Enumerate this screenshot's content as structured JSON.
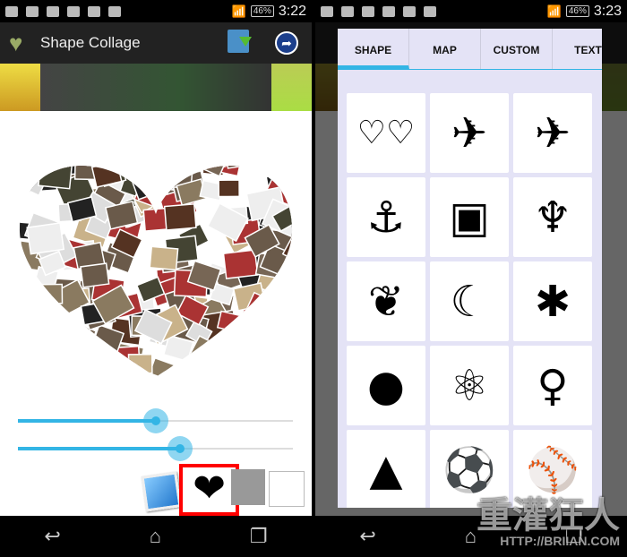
{
  "left": {
    "status": {
      "battery": "46%",
      "time": "3:22"
    },
    "app_title": "Shape Collage",
    "icons": {
      "save": "save-download-icon",
      "share": "share-arrow-icon"
    },
    "sliders": [
      {
        "value_pct": 50
      },
      {
        "value_pct": 59
      }
    ],
    "selected_shape": "heart",
    "colors": {
      "accent": "#33b5e5",
      "highlight": "#ff0000",
      "swatch1": "#999999",
      "swatch2": "#ffffff"
    }
  },
  "right": {
    "status": {
      "battery": "46%",
      "time": "3:23"
    },
    "tabs": [
      {
        "label": "SHAPE",
        "selected": true
      },
      {
        "label": "MAP"
      },
      {
        "label": "CUSTOM"
      },
      {
        "label": "TEXT"
      }
    ],
    "shapes": [
      {
        "name": "two-hearts",
        "glyph": "♡♡"
      },
      {
        "name": "airplane",
        "glyph": "✈"
      },
      {
        "name": "cartoon-plane",
        "glyph": "✈"
      },
      {
        "name": "anchor",
        "glyph": "⚓"
      },
      {
        "name": "android",
        "glyph": "▣"
      },
      {
        "name": "angel",
        "glyph": "♆"
      },
      {
        "name": "wings",
        "glyph": "❦"
      },
      {
        "name": "sailor-moon",
        "glyph": "☾"
      },
      {
        "name": "ant",
        "glyph": "✱"
      },
      {
        "name": "apple",
        "glyph": "●"
      },
      {
        "name": "atom",
        "glyph": "⚛"
      },
      {
        "name": "woman-silhouette",
        "glyph": "♀"
      },
      {
        "name": "temple",
        "glyph": "▲"
      },
      {
        "name": "soccer-ball",
        "glyph": "⚽"
      },
      {
        "name": "baseball-player",
        "glyph": "⚾"
      }
    ]
  },
  "watermark": {
    "text": "重灌狂人",
    "url": "HTTP://BRIIAN.COM"
  }
}
